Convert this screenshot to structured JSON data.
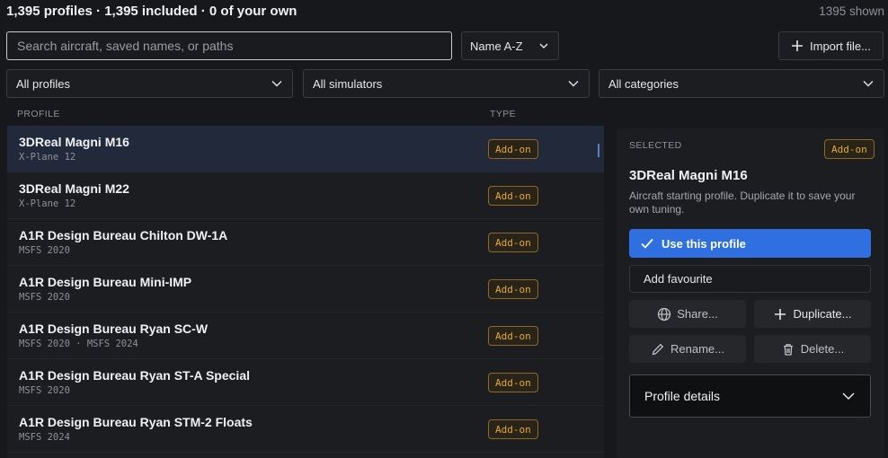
{
  "header": {
    "summary": "1,395 profiles · 1,395 included · 0 of your own",
    "shown": "1395 shown"
  },
  "search": {
    "placeholder": "Search aircraft, saved names, or paths",
    "value": ""
  },
  "sort": {
    "label": "Name A-Z"
  },
  "import_button": {
    "label": "Import file..."
  },
  "filters": [
    {
      "label": "All profiles"
    },
    {
      "label": "All simulators"
    },
    {
      "label": "All categories"
    }
  ],
  "columns": {
    "profile": "PROFILE",
    "type": "TYPE"
  },
  "rows": [
    {
      "name": "3DReal Magni M16",
      "sim": "X-Plane 12",
      "type": "Add-on",
      "selected": true
    },
    {
      "name": "3DReal Magni M22",
      "sim": "X-Plane 12",
      "type": "Add-on"
    },
    {
      "name": "A1R Design Bureau Chilton DW-1A",
      "sim": "MSFS 2020",
      "type": "Add-on"
    },
    {
      "name": "A1R Design Bureau Mini-IMP",
      "sim": "MSFS 2020",
      "type": "Add-on"
    },
    {
      "name": "A1R Design Bureau Ryan SC-W",
      "sim": "MSFS 2020 · MSFS 2024",
      "type": "Add-on"
    },
    {
      "name": "A1R Design Bureau Ryan ST-A Special",
      "sim": "MSFS 2020",
      "type": "Add-on"
    },
    {
      "name": "A1R Design Bureau Ryan STM-2 Floats",
      "sim": "MSFS 2024",
      "type": "Add-on"
    }
  ],
  "panel": {
    "label": "SELECTED",
    "badge": "Add-on",
    "title": "3DReal Magni M16",
    "description": "Aircraft starting profile. Duplicate it to save your own tuning.",
    "use_label": "Use this profile",
    "favourite_label": "Add favourite",
    "share_label": "Share...",
    "duplicate_label": "Duplicate...",
    "rename_label": "Rename...",
    "delete_label": "Delete...",
    "details_label": "Profile details"
  },
  "colors": {
    "accent": "#2f6fe0",
    "badge": "#e0a83c",
    "background": "#17181b"
  }
}
